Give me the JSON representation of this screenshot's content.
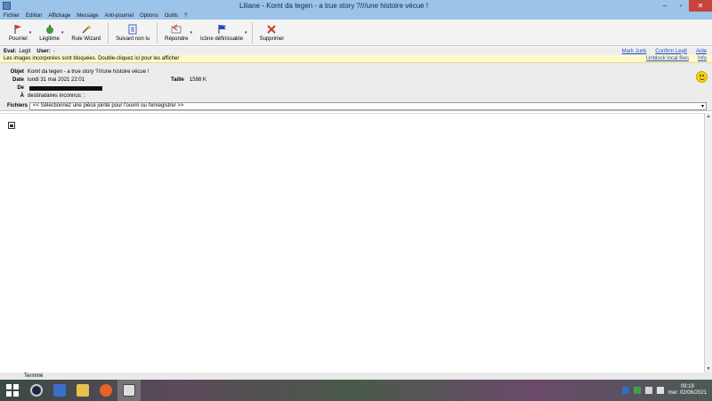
{
  "window": {
    "title": "Liliane - Komt da tegen - a true story ?///une histoire vécue !",
    "controls": {
      "minimize": "–",
      "maximize": "▫",
      "close": "✕"
    }
  },
  "menu": [
    "Fichier",
    "Edition",
    "Affichage",
    "Message",
    "Anti-pourriel",
    "Options",
    "Outils",
    "?"
  ],
  "toolbar": {
    "buttons": [
      {
        "label": "Pourriel",
        "icon": "spam-flag-icon"
      },
      {
        "label": "Légitime",
        "icon": "legit-icon"
      },
      {
        "label": "Rule Wizard",
        "icon": "wand-icon"
      },
      {
        "label": "Suivant non lu",
        "icon": "next-unread-icon"
      },
      {
        "label": "Répondre",
        "icon": "reply-icon"
      },
      {
        "label": "Icône définissable",
        "icon": "flag-icon"
      },
      {
        "label": "Supprimer",
        "icon": "delete-icon"
      }
    ]
  },
  "eval": {
    "label": "Eval:",
    "value": "Legit",
    "user_label": "User:",
    "user_value": "-",
    "links": [
      "Mark Junk",
      "Confirm Legit",
      "Aide"
    ]
  },
  "infobar": {
    "text": "Les images incorporées sont bloquées.  Double-cliquez ici pour les afficher",
    "links": [
      "Unblock local files",
      "Info"
    ]
  },
  "header": {
    "subject_label": "Objet",
    "subject": "Komt da tegen - a true story ?///une histoire vécue !",
    "date_label": "Date",
    "date": "lundi 31 mai 2021 22:01",
    "size_label": "Taille",
    "size": "1588 K",
    "from_label": "De",
    "to_label": "À",
    "to": "destinataires inconnus: ;"
  },
  "attachments": {
    "label": "Fichiers",
    "placeholder": "<< Sélectionnez une pièce jointe pour l'ouvrir ou l'enregistrer >>"
  },
  "status": {
    "text": "Terminé"
  },
  "taskbar": {
    "clock_time": "09:19",
    "clock_date": "mer. 02/06/2021"
  },
  "colors": {
    "titlebar": "#9cc3e8",
    "close_button": "#c7443b",
    "infobar": "#fff8c8",
    "link": "#1f4fbf"
  }
}
